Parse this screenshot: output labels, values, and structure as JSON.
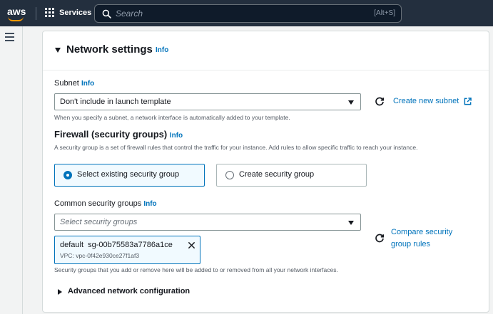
{
  "nav": {
    "logo": "aws",
    "services_label": "Services",
    "search_placeholder": "Search",
    "search_shortcut": "[Alt+S]"
  },
  "panel": {
    "title": "Network settings",
    "title_info": "Info",
    "subnet": {
      "label": "Subnet",
      "info": "Info",
      "selected": "Don't include in launch template",
      "create_link": "Create new subnet",
      "description": "When you specify a subnet, a network interface is automatically added to your template."
    },
    "firewall": {
      "title": "Firewall (security groups)",
      "info": "Info",
      "description": "A security group is a set of firewall rules that control the traffic for your instance. Add rules to allow specific traffic to reach your instance.",
      "options": [
        {
          "label": "Select existing security group",
          "selected": true
        },
        {
          "label": "Create security group",
          "selected": false
        }
      ]
    },
    "common_sg": {
      "label": "Common security groups",
      "info": "Info",
      "placeholder": "Select security groups",
      "compare_link": "Compare security group rules",
      "token_name": "default",
      "token_id": "sg-00b75583a7786a1ce",
      "token_vpc": "VPC: vpc-0f42e930ce27f1af3",
      "description": "Security groups that you add or remove here will be added to or removed from all your network interfaces."
    },
    "advanced_label": "Advanced network configuration"
  },
  "colors": {
    "nav_bg": "#232f3e",
    "link": "#0073bb",
    "accent_orange": "#ff9900"
  }
}
